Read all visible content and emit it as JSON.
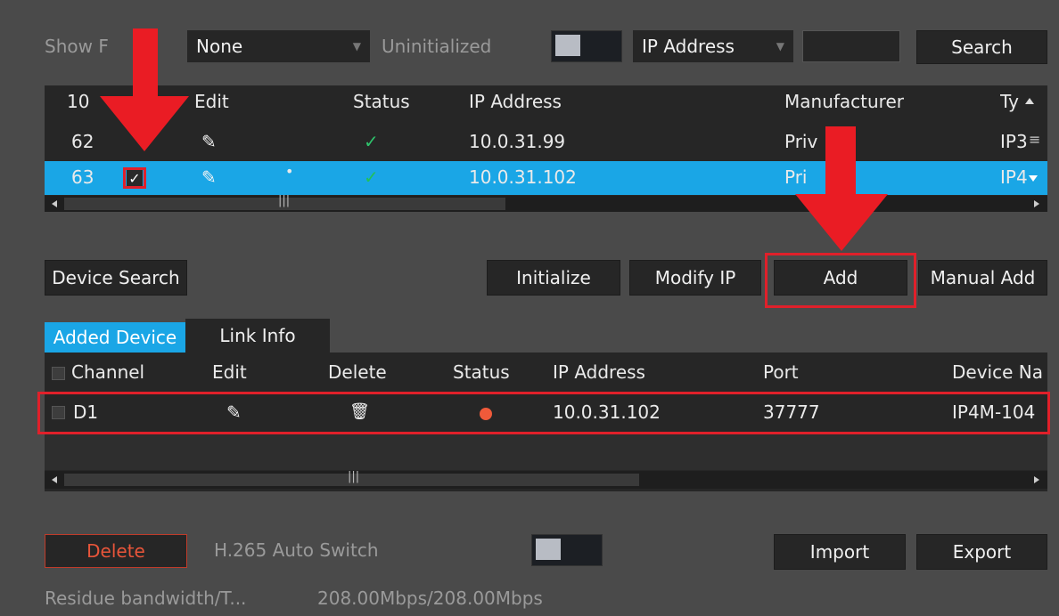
{
  "filters": {
    "show_filter_label": "Show F",
    "filter_select_value": "None",
    "uninitialized_label": "Uninitialized",
    "search_type_value": "IP Address",
    "search_input_value": "",
    "search_button": "Search"
  },
  "search_table": {
    "columns": [
      "10",
      "Edit",
      "Status",
      "IP Address",
      "Manufacturer",
      "Ty"
    ],
    "rows": [
      {
        "num": "62",
        "ip": "10.0.31.99",
        "manufacturer": "Priv",
        "type": "IP3"
      },
      {
        "num": "63",
        "ip": "10.0.31.102",
        "manufacturer": "Pri",
        "type": "IP4"
      }
    ],
    "row_check_mark": "✓",
    "scroll_mark": "|||"
  },
  "actions": {
    "device_search": "Device Search",
    "initialize": "Initialize",
    "modify_ip": "Modify IP",
    "add": "Add",
    "manual_add": "Manual Add"
  },
  "tabs": {
    "added_device": "Added Device",
    "link_info": "Link Info"
  },
  "added_table": {
    "columns": [
      "Channel",
      "Edit",
      "Delete",
      "Status",
      "IP Address",
      "Port",
      "Device Na"
    ],
    "rows": [
      {
        "channel": "D1",
        "ip": "10.0.31.102",
        "port": "37777",
        "device_name": "IP4M-104"
      }
    ],
    "scroll_mark": "|||"
  },
  "footer": {
    "delete_button": "Delete",
    "h265_label": "H.265 Auto Switch",
    "import_button": "Import",
    "export_button": "Export",
    "bandwidth_label": "Residue bandwidth/T...",
    "bandwidth_value": "208.00Mbps/208.00Mbps"
  },
  "icons": {
    "edit": "pencil-icon",
    "status_ok": "check-icon",
    "delete": "trash-icon",
    "status_offline": "red-dot-icon"
  },
  "colors": {
    "selection": "#1aa6e6",
    "highlight_red": "#e0202a",
    "delete_text": "#e8553a"
  }
}
